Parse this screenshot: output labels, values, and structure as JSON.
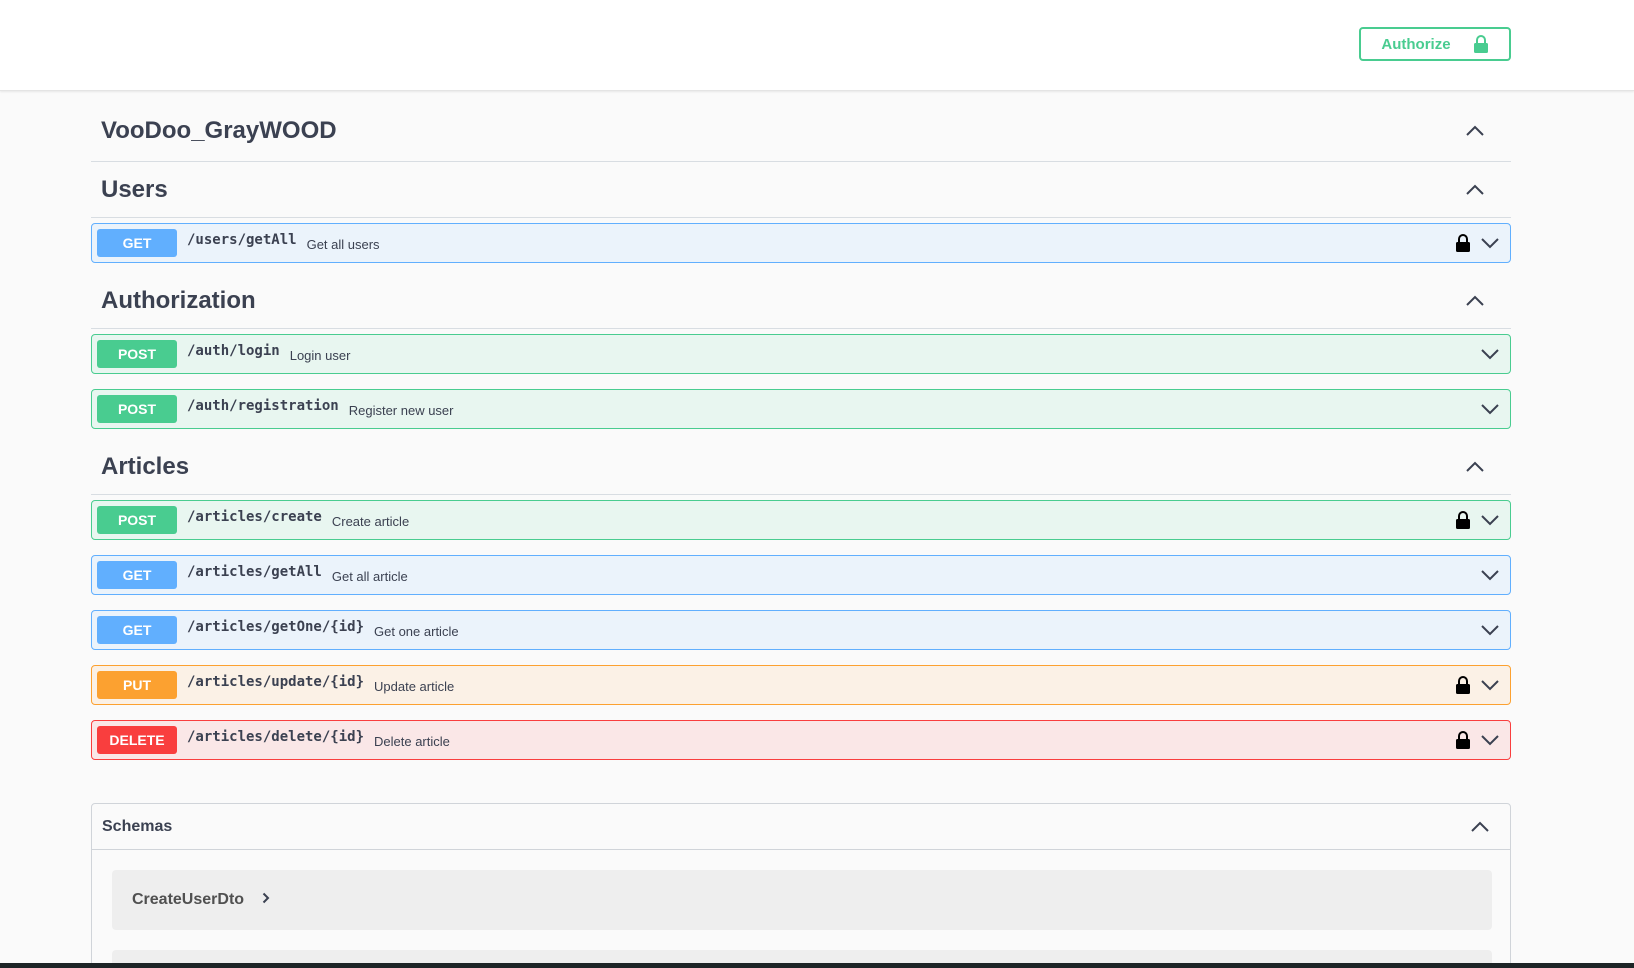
{
  "header": {
    "authorize_label": "Authorize"
  },
  "api_title": "VooDoo_GrayWOOD",
  "sections": [
    {
      "title": "Users",
      "operations": [
        {
          "method": "GET",
          "path": "/users/getAll",
          "summary": "Get all users",
          "locked": true
        }
      ]
    },
    {
      "title": "Authorization",
      "operations": [
        {
          "method": "POST",
          "path": "/auth/login",
          "summary": "Login user",
          "locked": false
        },
        {
          "method": "POST",
          "path": "/auth/registration",
          "summary": "Register new user",
          "locked": false
        }
      ]
    },
    {
      "title": "Articles",
      "operations": [
        {
          "method": "POST",
          "path": "/articles/create",
          "summary": "Create article",
          "locked": true
        },
        {
          "method": "GET",
          "path": "/articles/getAll",
          "summary": "Get all article",
          "locked": false
        },
        {
          "method": "GET",
          "path": "/articles/getOne/{id}",
          "summary": "Get one article",
          "locked": false
        },
        {
          "method": "PUT",
          "path": "/articles/update/{id}",
          "summary": "Update article",
          "locked": true
        },
        {
          "method": "DELETE",
          "path": "/articles/delete/{id}",
          "summary": "Delete article",
          "locked": true
        }
      ]
    }
  ],
  "schemas": {
    "title": "Schemas",
    "models": [
      {
        "name": "CreateUserDto"
      }
    ]
  },
  "icons": {
    "lock": "lock-icon",
    "expand": "chevron-down-icon",
    "collapse": "chevron-up-icon",
    "model_expand": "chevron-right-icon"
  },
  "colors": {
    "get": "#61affe",
    "post": "#49cc90",
    "put": "#fca130",
    "delete": "#f93e3e"
  }
}
